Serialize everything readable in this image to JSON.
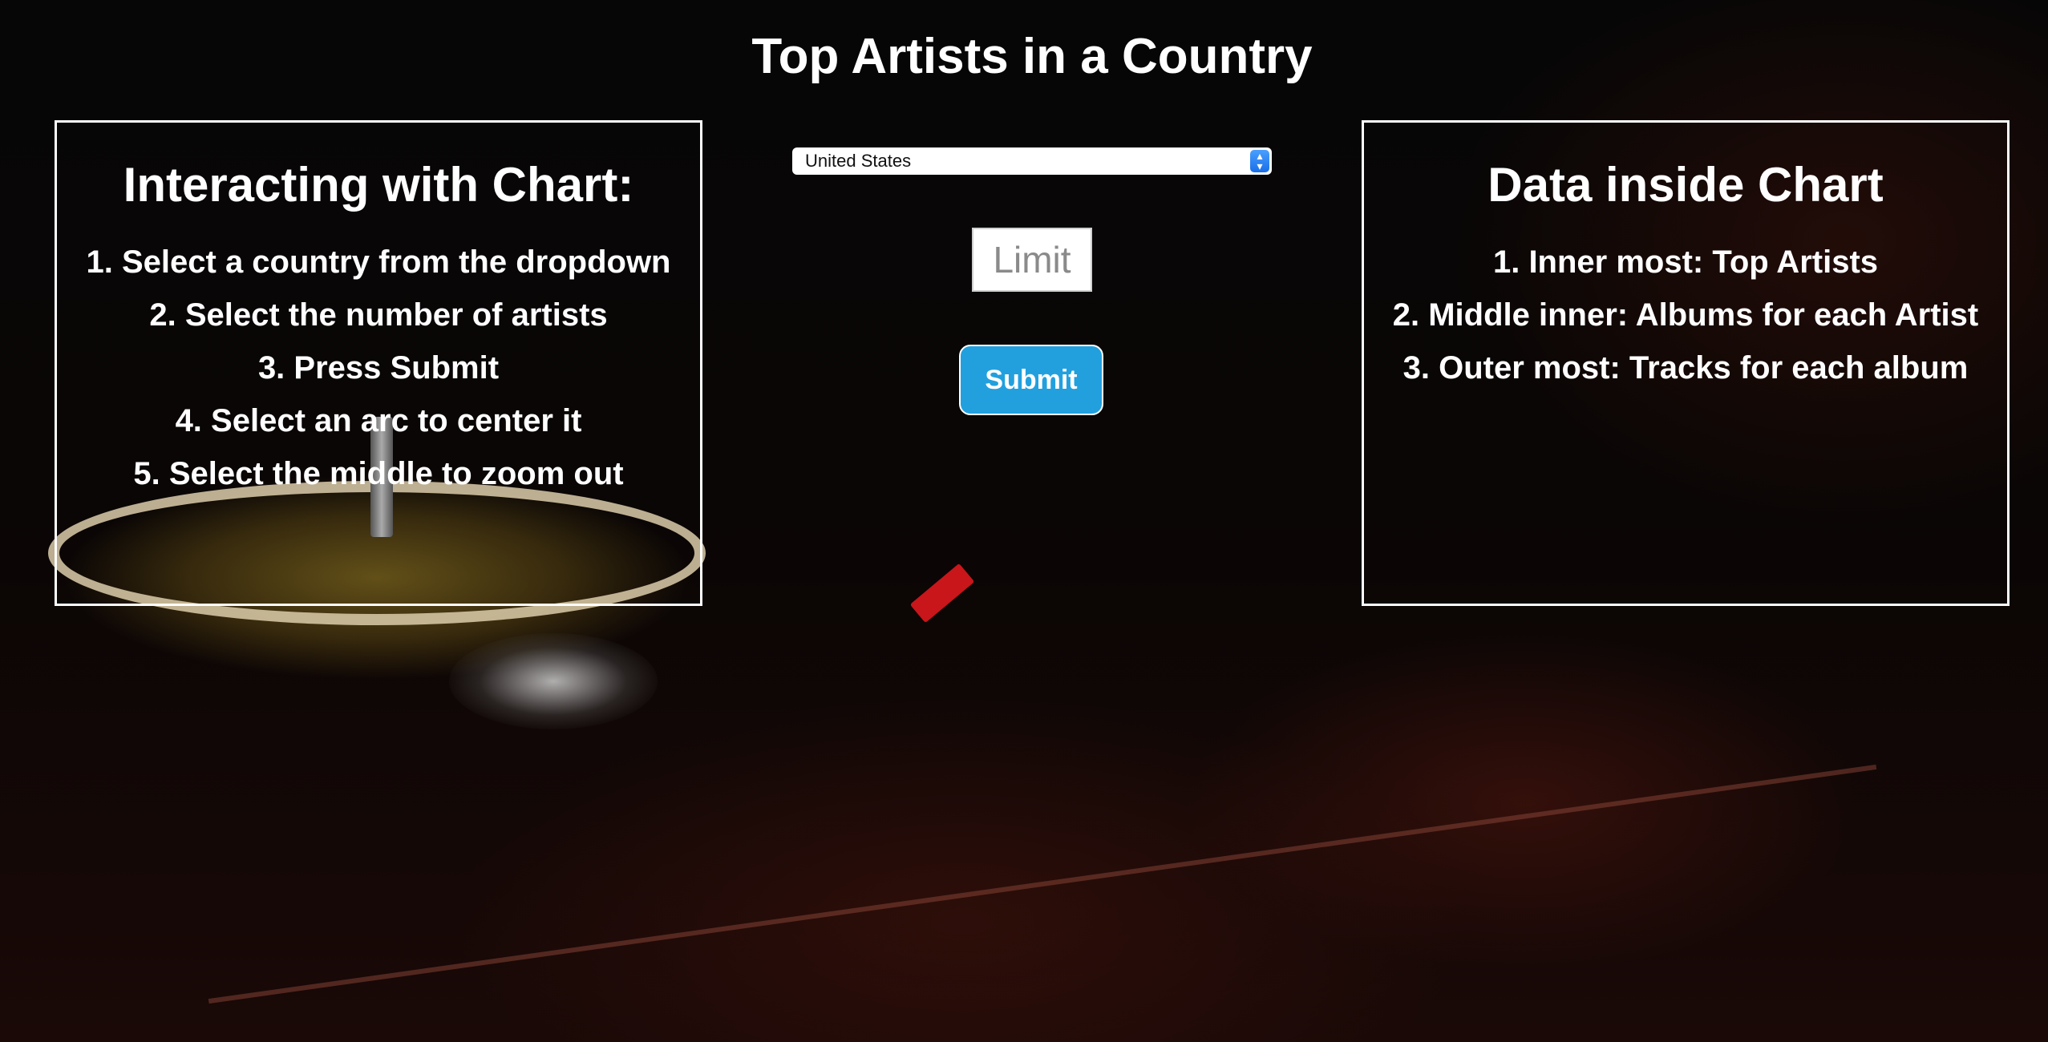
{
  "page": {
    "title": "Top Artists in a Country"
  },
  "left_box": {
    "title": "Interacting with Chart:",
    "items": [
      "1. Select a country from the dropdown",
      "2. Select the number of artists",
      "3. Press Submit",
      "4. Select an arc to center it",
      "5. Select the middle to zoom out"
    ]
  },
  "right_box": {
    "title": "Data inside Chart",
    "items": [
      "1. Inner most: Top Artists",
      "2. Middle inner: Albums for each Artist",
      "3. Outer most: Tracks for each album"
    ]
  },
  "controls": {
    "country_selected": "United States",
    "limit_placeholder": "Limit",
    "submit_label": "Submit"
  },
  "colors": {
    "accent": "#22a0de",
    "text": "#ffffff"
  }
}
